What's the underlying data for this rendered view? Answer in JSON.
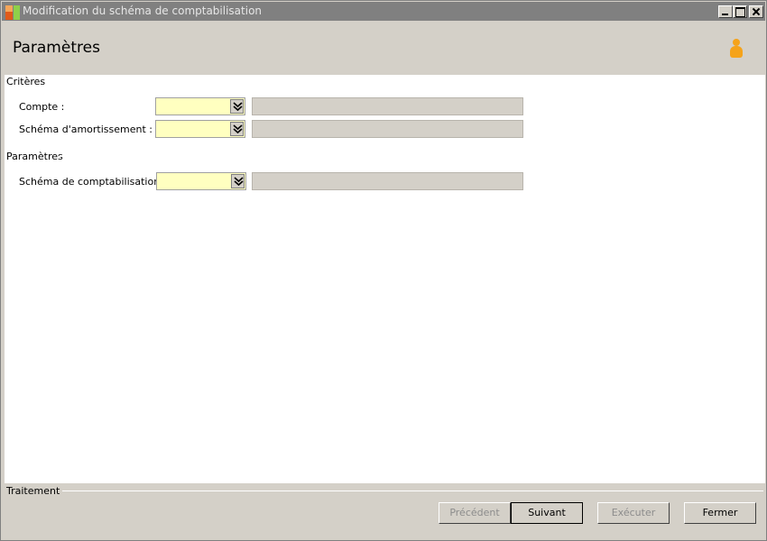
{
  "window": {
    "title": "Modification du schéma de comptabilisation"
  },
  "header": {
    "title": "Paramètres"
  },
  "criteria": {
    "group_title": "Critères",
    "compte": {
      "label": "Compte :",
      "value": "",
      "description": ""
    },
    "schema_amortissement": {
      "label": "Schéma d'amortissement :",
      "value": "",
      "description": ""
    }
  },
  "parameters": {
    "group_title": "Paramètres",
    "schema_comptabilisation": {
      "label": "Schéma de comptabilisation :",
      "value": "",
      "description": ""
    }
  },
  "footer": {
    "group_title": "Traitement",
    "buttons": {
      "precedent": "Précédent",
      "suivant": "Suivant",
      "executer": "Exécuter",
      "fermer": "Fermer"
    }
  },
  "icons": {
    "app": "app-icon",
    "user": "user-icon",
    "dropdown": "double-chevron-down-icon"
  },
  "colors": {
    "required_field": "#ffffc0",
    "titlebar": "#808080"
  }
}
